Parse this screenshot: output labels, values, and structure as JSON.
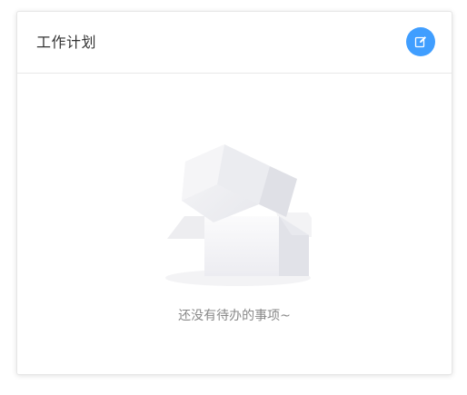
{
  "card": {
    "title": "工作计划"
  },
  "actions": {
    "edit_icon": "edit-icon",
    "accent_color": "#409eff"
  },
  "empty_state": {
    "icon": "empty-box-illustration",
    "text": "还没有待办的事项~"
  }
}
